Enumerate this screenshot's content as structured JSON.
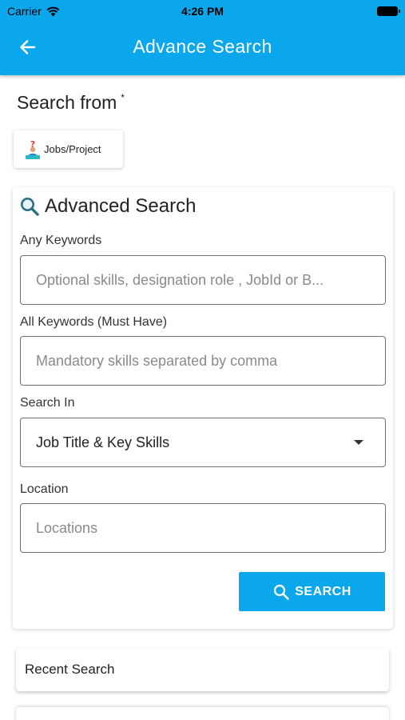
{
  "status_bar": {
    "carrier": "Carrier",
    "time": "4:26 PM"
  },
  "header": {
    "title": "Advance Search",
    "back_icon": "arrow-left-icon"
  },
  "search_from": {
    "label": "Search from",
    "required_mark": "*",
    "chip_label": "Jobs/Project",
    "chip_icon": "jobs-project-icon"
  },
  "advanced_search": {
    "title": "Advanced Search",
    "title_icon": "search-icon",
    "any_keywords": {
      "label": "Any Keywords",
      "placeholder": "Optional skills, designation role , JobId or B..."
    },
    "all_keywords": {
      "label": "All Keywords (Must Have)",
      "placeholder": "Mandatory skills separated by comma"
    },
    "search_in": {
      "label": "Search In",
      "value": "Job Title & Key Skills"
    },
    "location": {
      "label": "Location",
      "placeholder": "Locations"
    },
    "search_button": "SEARCH"
  },
  "recent_search": {
    "label": "Recent Search"
  },
  "colors": {
    "primary": "#0aa7ec",
    "white": "#ffffff",
    "text": "#222222"
  }
}
